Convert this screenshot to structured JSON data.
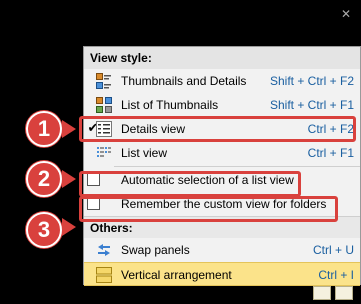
{
  "menu": {
    "sections": {
      "view_style": "View style:",
      "others": "Others:"
    },
    "items": [
      {
        "label": "Thumbnails and Details",
        "shortcut": "Shift + Ctrl + F2"
      },
      {
        "label": "List of Thumbnails",
        "shortcut": "Shift + Ctrl + F1"
      },
      {
        "label": "Details view",
        "shortcut": "Ctrl + F2",
        "checked": true
      },
      {
        "label": "List view",
        "shortcut": "Ctrl + F1"
      },
      {
        "label": "Automatic selection of a list view",
        "checked": false
      },
      {
        "label": "Remember the custom view for folders",
        "checked": false
      },
      {
        "label": "Swap panels",
        "shortcut": "Ctrl + U"
      },
      {
        "label": "Vertical arrangement",
        "shortcut": "Ctrl + I",
        "highlighted": true
      }
    ],
    "check_glyph": "✔"
  },
  "callouts": [
    "1",
    "2",
    "3"
  ],
  "colors": {
    "callout_red": "#d9413d",
    "highlight_bg": "#fbe38a",
    "shortcut_blue": "#1a5fa0"
  }
}
